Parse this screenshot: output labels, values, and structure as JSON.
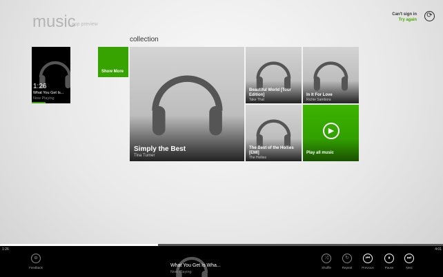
{
  "header": {
    "title": "music",
    "subtitle": "app preview",
    "signin_status": "Can't sign in",
    "signin_action": "Try again"
  },
  "now_playing_tile": {
    "time": "1:26",
    "track": "What You Get Is...",
    "label": "Now Playing",
    "progress": 0.357
  },
  "show_more": "Show More",
  "collection": {
    "label": "collection",
    "albums": [
      {
        "title": "Simply the Best",
        "artist": "Tina Turner"
      },
      {
        "title": "Beautiful World [Tour Edition]",
        "artist": "Take That"
      },
      {
        "title": "In It For Love",
        "artist": "Richie Sambora"
      },
      {
        "title": "The Best of the Hollies [EMI]",
        "artist": "The Hollies"
      }
    ],
    "play_all": "Play all music"
  },
  "player": {
    "elapsed": "1:26",
    "duration": "4:01",
    "progress": 0.357,
    "track": "What You Get Is Wha...",
    "status": "Now Playing",
    "feedback": "Feedback",
    "shuffle": "Shuffle",
    "repeat": "Repeat",
    "previous": "Previous",
    "pause": "Pause",
    "next": "Next"
  },
  "colors": {
    "accent": "#37a300"
  }
}
